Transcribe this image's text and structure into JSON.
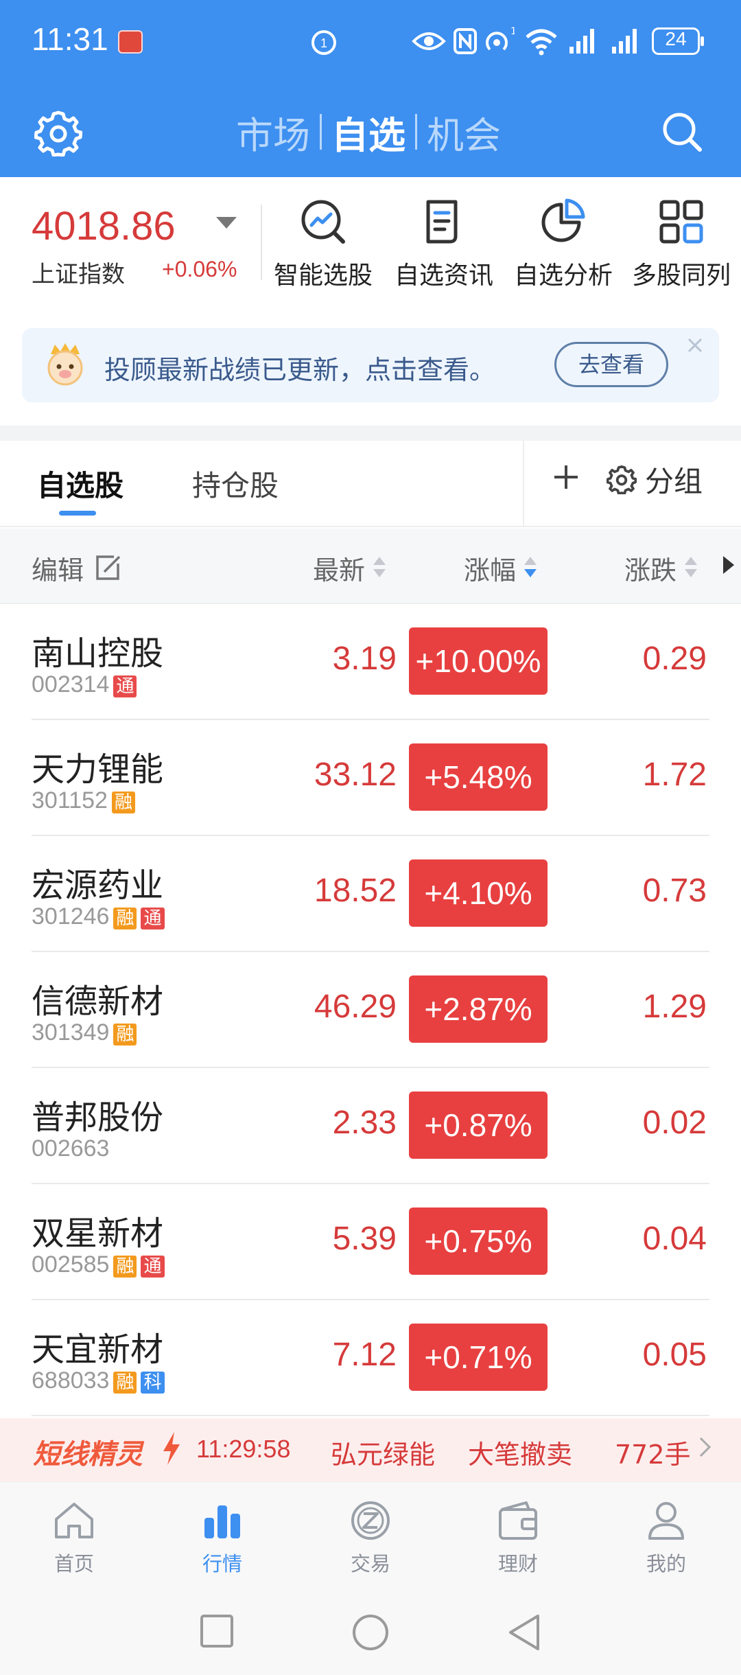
{
  "status_bar": {
    "time": "11:31",
    "battery": "24"
  },
  "top_nav": {
    "tabs": [
      {
        "label": "市场"
      },
      {
        "label": "自选"
      },
      {
        "label": "机会"
      }
    ],
    "active_tab": "自选"
  },
  "index": {
    "value": "4018.86",
    "name": "上证指数",
    "change": "+0.06%"
  },
  "shortcuts": [
    {
      "label": "智能选股",
      "icon": "trend-magnifier-icon"
    },
    {
      "label": "自选资讯",
      "icon": "document-icon"
    },
    {
      "label": "自选分析",
      "icon": "pie-chart-icon"
    },
    {
      "label": "多股同列",
      "icon": "grid-icon"
    }
  ],
  "notice": {
    "text": "投顾最新战绩已更新，点击查看。",
    "button": "去查看"
  },
  "watchlist_tabs": {
    "tabs": [
      {
        "label": "自选股"
      },
      {
        "label": "持仓股"
      }
    ],
    "group_label": "分组"
  },
  "columns": {
    "edit": "编辑",
    "latest": "最新",
    "pct": "涨幅",
    "change": "涨跌"
  },
  "stocks": [
    {
      "name": "南山控股",
      "code": "002314",
      "tags": [
        "通"
      ],
      "price": "3.19",
      "pct": "+10.00%",
      "change": "0.29"
    },
    {
      "name": "天力锂能",
      "code": "301152",
      "tags": [
        "融"
      ],
      "price": "33.12",
      "pct": "+5.48%",
      "change": "1.72"
    },
    {
      "name": "宏源药业",
      "code": "301246",
      "tags": [
        "融",
        "通"
      ],
      "price": "18.52",
      "pct": "+4.10%",
      "change": "0.73"
    },
    {
      "name": "信德新材",
      "code": "301349",
      "tags": [
        "融"
      ],
      "price": "46.29",
      "pct": "+2.87%",
      "change": "1.29"
    },
    {
      "name": "普邦股份",
      "code": "002663",
      "tags": [],
      "price": "2.33",
      "pct": "+0.87%",
      "change": "0.02"
    },
    {
      "name": "双星新材",
      "code": "002585",
      "tags": [
        "融",
        "通"
      ],
      "price": "5.39",
      "pct": "+0.75%",
      "change": "0.04"
    },
    {
      "name": "天宜新材",
      "code": "688033",
      "tags": [
        "融",
        "科"
      ],
      "price": "7.12",
      "pct": "+0.71%",
      "change": "0.05"
    }
  ],
  "tag_colors": {
    "融": "#f39a1e",
    "通": "#e84a4a",
    "科": "#3d8ff0"
  },
  "ticker": {
    "brand": "短线精灵",
    "time": "11:29:58",
    "stock": "弘元绿能",
    "event": "大笔撤卖",
    "volume": "772手"
  },
  "bottom_nav": [
    {
      "label": "首页",
      "icon": "home-icon"
    },
    {
      "label": "行情",
      "icon": "bar-chart-icon"
    },
    {
      "label": "交易",
      "icon": "trade-icon"
    },
    {
      "label": "理财",
      "icon": "wallet-icon"
    },
    {
      "label": "我的",
      "icon": "user-icon"
    }
  ],
  "active_bottom_tab": "行情",
  "colors": {
    "primary_blue": "#3d8ff0",
    "rise_red": "#d63a3a",
    "pct_box_red": "#e84040"
  }
}
